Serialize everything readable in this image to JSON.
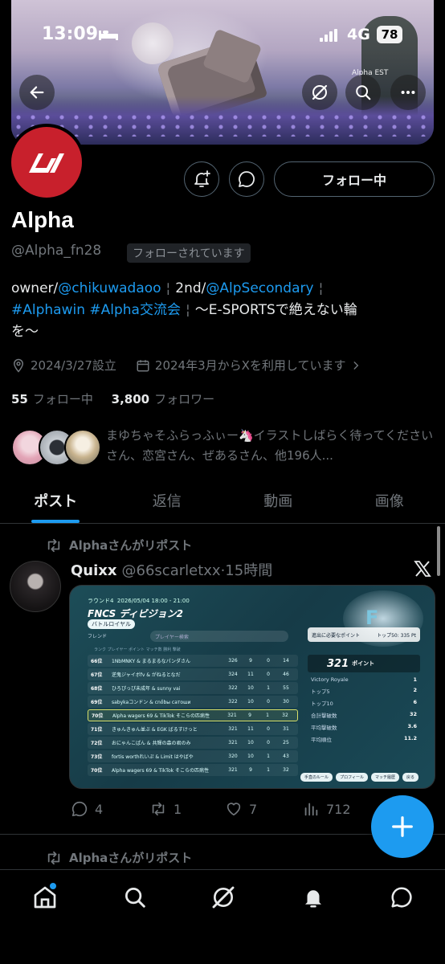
{
  "status_bar": {
    "time": "13:09",
    "network": "4G",
    "battery": "78"
  },
  "banner": {
    "overlay_text": "Alpha EST"
  },
  "profile": {
    "name": "Alpha",
    "handle": "@Alpha_fn28",
    "follows_you": "フォローされています",
    "follow_button": "フォロー中",
    "bio": {
      "line1_prefix": "owner/",
      "line1_link": "@chikuwadaoo",
      "line1_sep": "¦",
      "line1_mid": "2nd/",
      "line1_link2": "@AlpSecondary",
      "line1_sep2": "¦",
      "line2_tag1": "#Alphawin",
      "line2_tag2": "#Alpha交流会",
      "line2_sep": "¦",
      "line2_text": "〜E-SPORTSで絶えない輪",
      "line3_text": "を〜"
    },
    "meta": {
      "founded": "2024/3/27設立",
      "joined": "2024年3月からXを利用しています"
    },
    "following_count": "55",
    "following_label": "フォロー中",
    "followers_count": "3,800",
    "followers_label": "フォロワー",
    "known_followers": "まゆちゃそふらっふぃー🦄イラストしばらく待ってくださいさん、恋宮さん、ぜあるさん、他196人..."
  },
  "tabs": [
    {
      "label": "ポスト",
      "active": true
    },
    {
      "label": "返信",
      "active": false
    },
    {
      "label": "動画",
      "active": false
    },
    {
      "label": "画像",
      "active": false
    }
  ],
  "post": {
    "repost_label": "Alphaさんがリポスト",
    "author_name": "Quixx",
    "author_handle": "@66scarletxx",
    "time": "·15時間",
    "image": {
      "round": "ラウンド4",
      "date": "2026/05/04 18:00 - 21:00",
      "title": "FNCS ディビジョン2",
      "badge": "バトルロイヤル",
      "search_placeholder": "プレイヤー検索",
      "friend_toggle": "フレンド",
      "columns": "ランク  プレイヤー  ポイント  マッチ数  勝利  撃破",
      "rows": [
        {
          "rank": "66位",
          "name": "1NbMNKY & まるまるなパンダさん",
          "pts": "326",
          "m": "9",
          "w": "0",
          "k": "14",
          "hl": false
        },
        {
          "rank": "67位",
          "name": "逆鬼ジャイボfv & がねるとなだ",
          "pts": "324",
          "m": "11",
          "w": "0",
          "k": "46",
          "hl": false
        },
        {
          "rank": "68位",
          "name": "ひろぴっぴ未成年 & sunny vai",
          "pts": "322",
          "m": "10",
          "w": "1",
          "k": "55",
          "hl": false
        },
        {
          "rank": "69位",
          "name": "sabykaコンドン & cnőbы сатоши",
          "pts": "322",
          "m": "10",
          "w": "0",
          "k": "30",
          "hl": false
        },
        {
          "rank": "70位",
          "name": "Alpha wagers 69 & TikTok そこらの匹病性",
          "pts": "321",
          "m": "9",
          "w": "1",
          "k": "32",
          "hl": true
        },
        {
          "rank": "71位",
          "name": "きゅんきゅん並ぶ & EGK ばるすけっと",
          "pts": "321",
          "m": "11",
          "w": "0",
          "k": "31",
          "hl": false
        },
        {
          "rank": "72位",
          "name": "おにゃんこぱん & 共輝の森の君のみ",
          "pts": "321",
          "m": "10",
          "w": "0",
          "k": "25",
          "hl": false
        },
        {
          "rank": "73位",
          "name": "fortis worthれいぷ & Limit はやばや",
          "pts": "320",
          "m": "10",
          "w": "1",
          "k": "43",
          "hl": false
        },
        {
          "rank": "70位",
          "name": "Alpha wagers 69 & TikTok そこらの匹病性",
          "pts": "321",
          "m": "9",
          "w": "1",
          "k": "32",
          "hl": false
        }
      ],
      "panel_top_left": "進出に必要なポイント",
      "panel_top_right": "トップ50: 335 Pt",
      "points": "321",
      "points_unit": "ポイント",
      "stats": [
        {
          "label": "Victory Royale",
          "value": "1"
        },
        {
          "label": "トップ5",
          "value": "2"
        },
        {
          "label": "トップ10",
          "value": "6"
        },
        {
          "label": "合計撃破数",
          "value": "32"
        },
        {
          "label": "平均撃破数",
          "value": "3.6"
        },
        {
          "label": "平均順位",
          "value": "11.2"
        }
      ],
      "buttons": [
        "手直のルール",
        "プロフィール",
        "マッチ履歴",
        "戻る"
      ]
    },
    "replies": "4",
    "reposts": "1",
    "likes": "7",
    "views": "712"
  },
  "next_repost_label": "Alphaさんがリポスト",
  "colors": {
    "accent": "#1d9bf0",
    "avatar_red": "#c8202c",
    "muted": "#71767b"
  }
}
